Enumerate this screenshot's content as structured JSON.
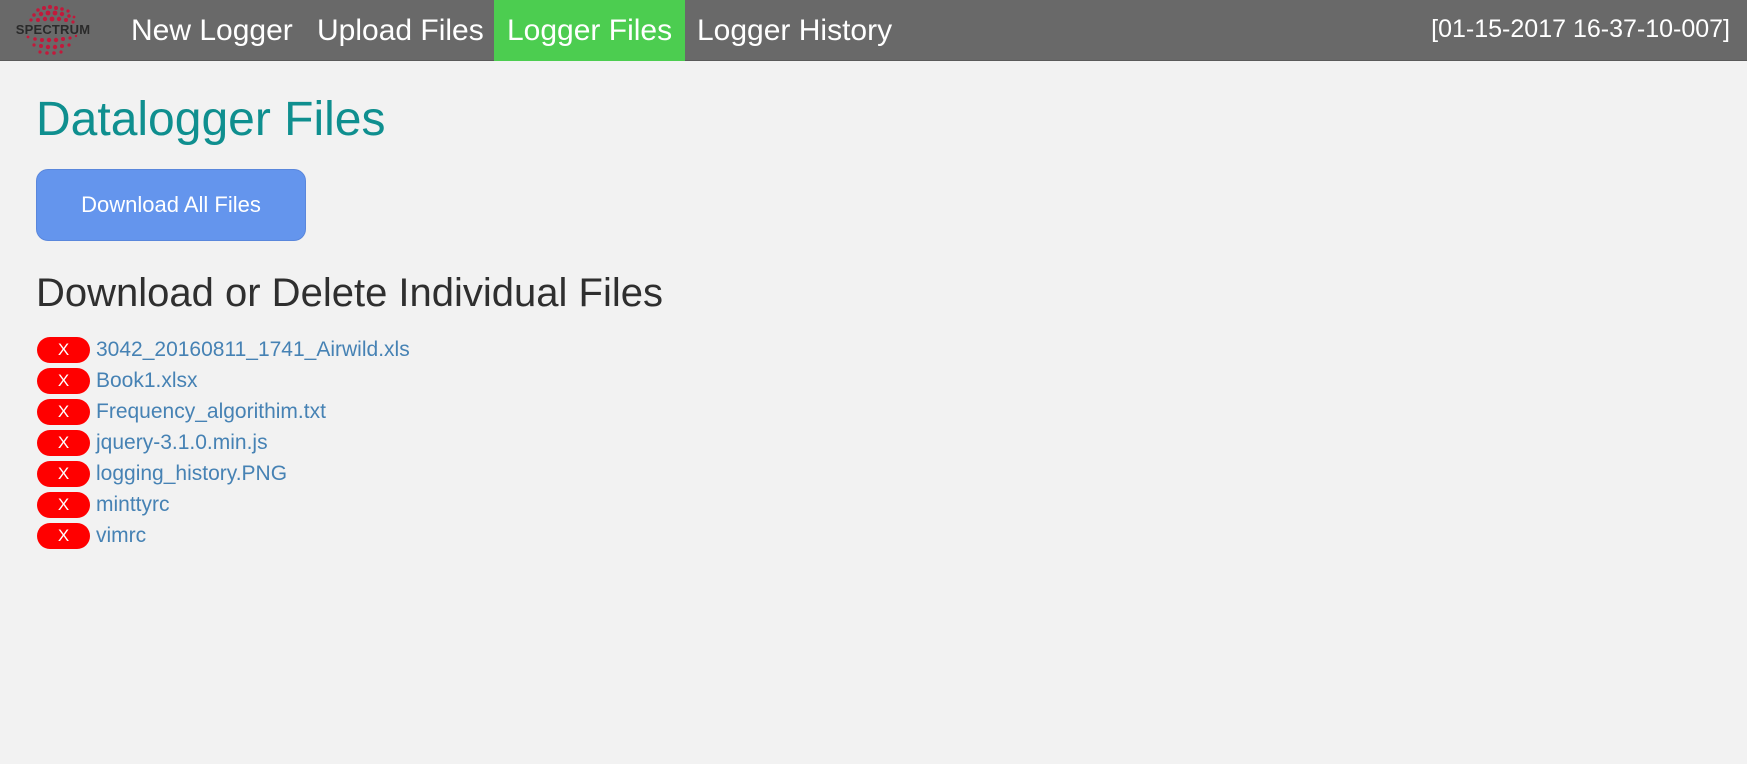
{
  "nav": {
    "logo_text": "SPECTRUM",
    "items": [
      {
        "label": "New Logger",
        "active": false
      },
      {
        "label": "Upload Files",
        "active": false
      },
      {
        "label": "Logger Files",
        "active": true
      },
      {
        "label": "Logger History",
        "active": false
      }
    ],
    "timestamp": "[01-15-2017 16-37-10-007]"
  },
  "main": {
    "title": "Datalogger Files",
    "download_all_label": "Download All Files",
    "section_title": "Download or Delete Individual Files",
    "delete_label": "X",
    "files": [
      "3042_20160811_1741_Airwild.xls",
      "Book1.xlsx",
      "Frequency_algorithim.txt",
      "jquery-3.1.0.min.js",
      "logging_history.PNG",
      "minttyrc",
      "vimrc"
    ]
  },
  "colors": {
    "navbar": "#696969",
    "active_tab": "#4ccd50",
    "title": "#0f8f8f",
    "download_button": "#6495ed",
    "delete_button": "#ff0000",
    "file_link": "#4682b4"
  }
}
